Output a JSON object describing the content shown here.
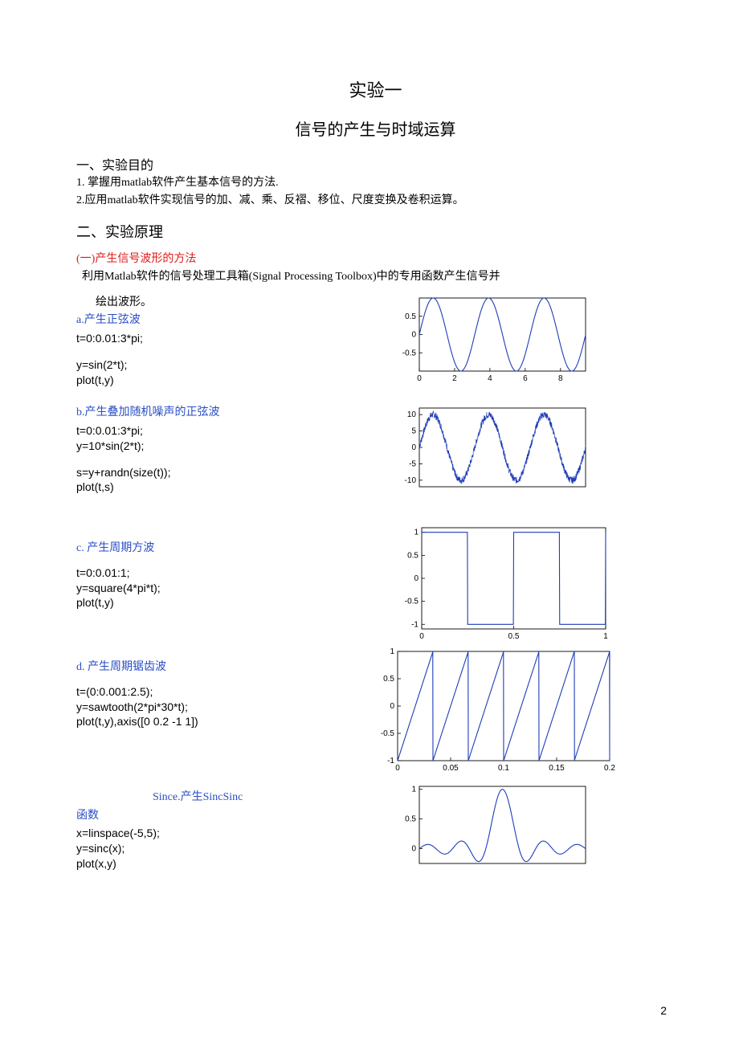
{
  "page_number": "2",
  "title1": "实验一",
  "title2": "信号的产生与时域运算",
  "section1_h": "一、实验目的",
  "goal1": "1.  掌握用matlab软件产生基本信号的方法.",
  "goal2": "2.应用matlab软件实现信号的加、减、乘、反褶、移位、尺度变换及卷积运算。",
  "section2_h": "二、实验原理",
  "sub1_h": "(一)产生信号波形的方法",
  "sub1_body": "  利用Matlab软件的信号处理工具箱(Signal Processing Toolbox)中的专用函数产生信号并",
  "sub1_tail": "绘出波形。",
  "a_h": "a.产生正弦波",
  "a_c1": "t=0:0.01:3*pi;",
  "a_c2": "y=sin(2*t);",
  "a_c3": "plot(t,y)",
  "b_h": "b.产生叠加随机噪声的正弦波",
  "b_c1": "t=0:0.01:3*pi;",
  "b_c2": "y=10*sin(2*t);",
  "b_c3": "s=y+randn(size(t));",
  "b_c4": "plot(t,s)",
  "c_h": "c.  产生周期方波",
  "c_c1": "t=0:0.01:1;",
  "c_c2": "y=square(4*pi*t);",
  "c_c3": "plot(t,y)",
  "d_h": "d.  产生周期锯齿波",
  "d_c1": "t=(0:0.001:2.5);",
  "d_c2": "y=sawtooth(2*pi*30*t);",
  "d_c3": "plot(t,y),axis([0 0.2 -1 1])",
  "e_h": "Since.产生SincSinc",
  "e_word": "函数",
  "e_c1": "x=linspace(-5,5);",
  "e_c2": "y=sinc(x);",
  "e_c3": "plot(x,y)",
  "chart_data": [
    {
      "id": "a",
      "type": "line",
      "xlim": [
        0,
        9.42
      ],
      "ylim": [
        -1,
        1
      ],
      "xticks": [
        0,
        2,
        4,
        6,
        8
      ],
      "yticks": [
        -0.5,
        0,
        0.5
      ],
      "series": [
        {
          "name": "sin(2t)",
          "expr": "sin(2*t)"
        }
      ]
    },
    {
      "id": "b",
      "type": "line",
      "xlim": [
        0,
        9.42
      ],
      "ylim": [
        -12,
        12
      ],
      "yticks": [
        -10,
        -5,
        0,
        5,
        10
      ],
      "series": [
        {
          "name": "10*sin(2t)+randn",
          "expr": "10*sin(2*t)+noise"
        }
      ]
    },
    {
      "id": "c",
      "type": "line",
      "xlim": [
        0,
        1
      ],
      "ylim": [
        -1.1,
        1.1
      ],
      "xticks": [
        0,
        0.5,
        1
      ],
      "yticks": [
        -1,
        -0.5,
        0,
        0.5,
        1
      ],
      "series": [
        {
          "name": "square(4*pi*t)",
          "period": 0.5
        }
      ]
    },
    {
      "id": "d",
      "type": "line",
      "xlim": [
        0,
        0.2
      ],
      "ylim": [
        -1,
        1
      ],
      "xticks": [
        0,
        0.05,
        0.1,
        0.15,
        0.2
      ],
      "yticks": [
        -1,
        -0.5,
        0,
        0.5,
        1
      ],
      "series": [
        {
          "name": "sawtooth(2*pi*30*t)",
          "period": 0.0333
        }
      ]
    },
    {
      "id": "e",
      "type": "line",
      "xlim": [
        -5,
        5
      ],
      "ylim": [
        -0.25,
        1.05
      ],
      "yticks": [
        0,
        0.5,
        1
      ],
      "series": [
        {
          "name": "sinc(x)"
        }
      ]
    }
  ]
}
